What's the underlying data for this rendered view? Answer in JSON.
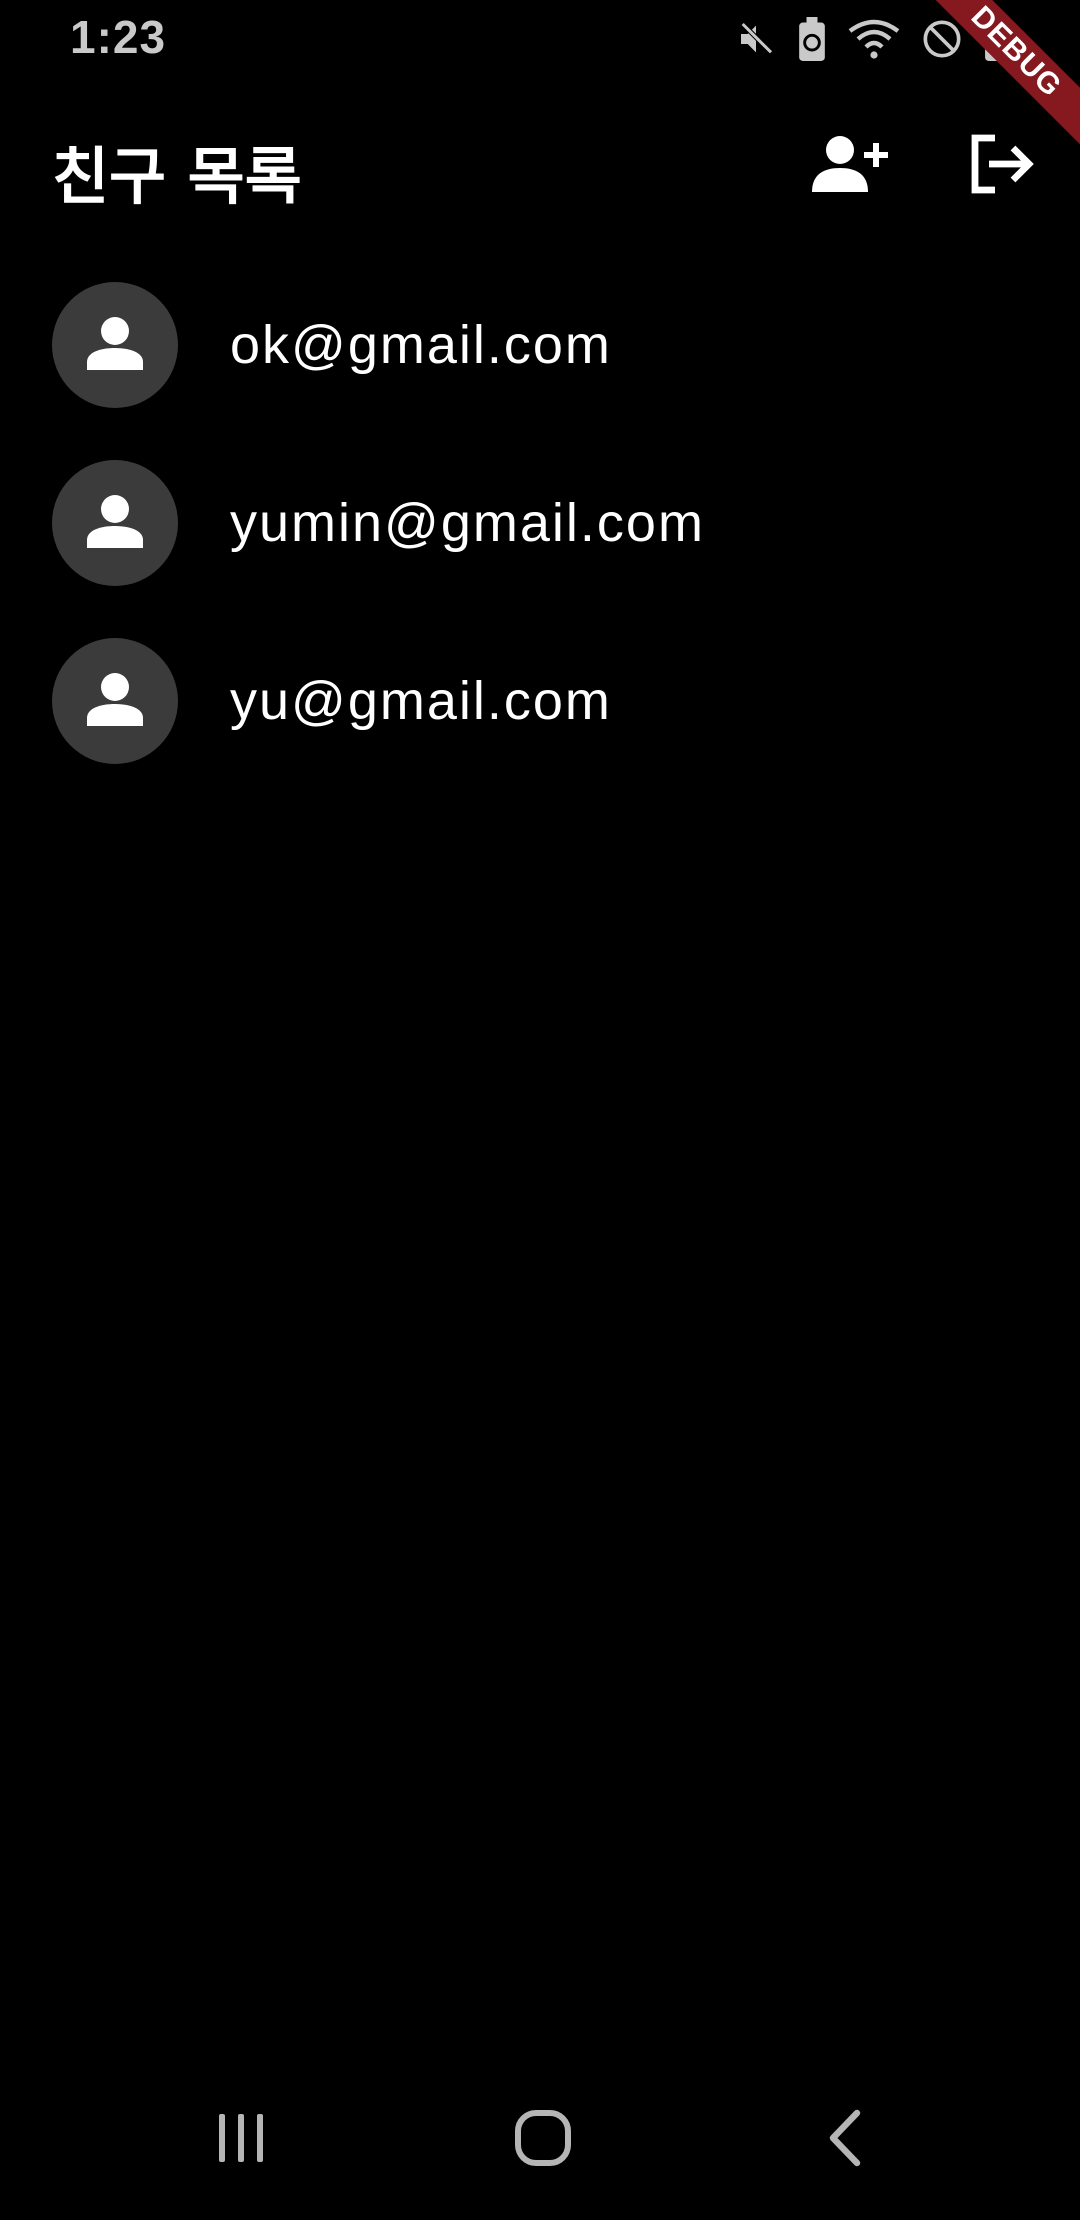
{
  "status_bar": {
    "time": "1:23",
    "icons": [
      "mute-icon",
      "battery-saver-icon",
      "wifi-icon",
      "do-not-disturb-icon",
      "battery-icon"
    ]
  },
  "debug_banner": "DEBUG",
  "app_bar": {
    "title": "친구 목록",
    "actions": [
      "person-add-icon",
      "logout-icon"
    ]
  },
  "friends": [
    {
      "email": "ok@gmail.com"
    },
    {
      "email": "yumin@gmail.com"
    },
    {
      "email": "yu@gmail.com"
    }
  ],
  "nav_bar": {
    "buttons": [
      "recents-icon",
      "home-icon",
      "back-icon"
    ]
  },
  "colors": {
    "background": "#000000",
    "avatar_bg": "#3b3b3b",
    "debug_ribbon": "#861920",
    "text": "#ffffff",
    "status_text": "#c9c9c9"
  }
}
